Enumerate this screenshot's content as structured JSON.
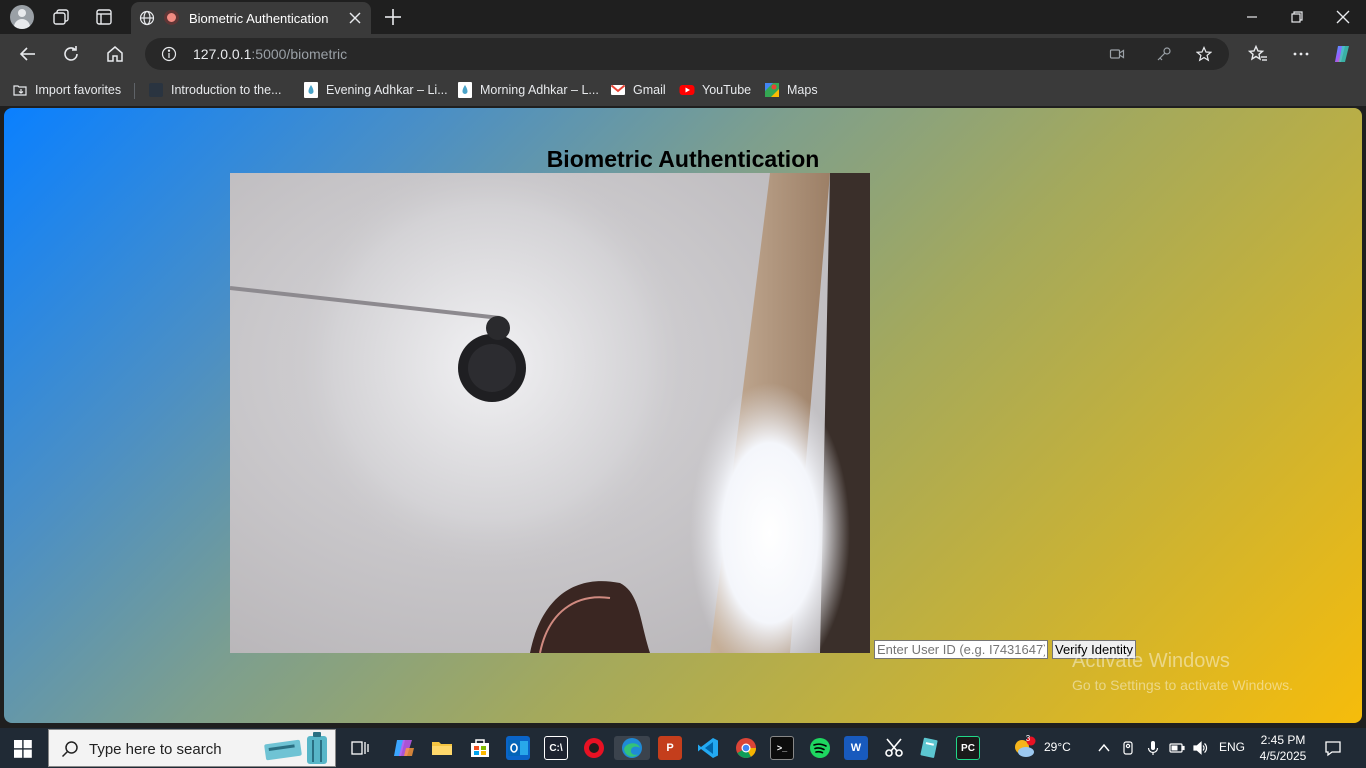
{
  "browser": {
    "tab": {
      "title": "Biometric Authentication",
      "recording": true
    },
    "address": {
      "host": "127.0.0.1",
      "path": ":5000/biometric"
    },
    "favorites": [
      {
        "label": "Import favorites",
        "icon": "import-icon"
      },
      {
        "label": "Introduction to the...",
        "icon": "page-icon"
      },
      {
        "label": "Evening Adhkar – Li...",
        "icon": "drop-icon"
      },
      {
        "label": "Morning Adhkar – L...",
        "icon": "drop-icon"
      },
      {
        "label": "Gmail",
        "icon": "gmail-icon"
      },
      {
        "label": "YouTube",
        "icon": "youtube-icon"
      },
      {
        "label": "Maps",
        "icon": "maps-icon"
      }
    ]
  },
  "page": {
    "title": "Biometric Authentication",
    "user_id_placeholder": "Enter User ID (e.g. I7431647)",
    "verify_label": "Verify Identity",
    "gradient": {
      "from": "#0a80ff",
      "to": "#f6bc0b"
    }
  },
  "watermark": {
    "line1": "Activate Windows",
    "line2": "Go to Settings to activate Windows."
  },
  "taskbar": {
    "search_placeholder": "Type here to search",
    "weather": {
      "temp": "29°C",
      "badge": "3"
    },
    "language": "ENG",
    "time": "2:45 PM",
    "date": "4/5/2025"
  }
}
